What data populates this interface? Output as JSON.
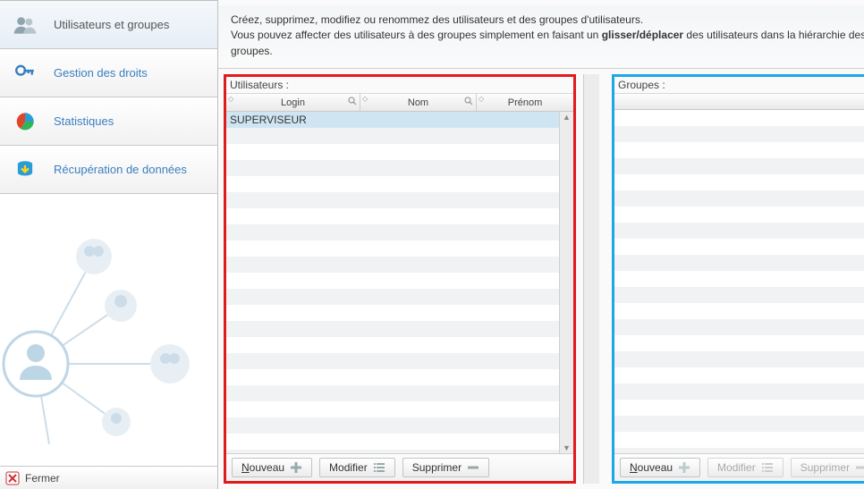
{
  "page_title_truncated": "",
  "description": {
    "line1": "Créez, supprimez, modifiez ou renommez des utilisateurs et des groupes d'utilisateurs.",
    "line2_a": "Vous pouvez affecter des utilisateurs à des groupes simplement en faisant un ",
    "line2_bold": "glisser/déplacer",
    "line2_b": " des utilisateurs dans la hiérarchie des groupes."
  },
  "sidebar": {
    "items": [
      {
        "label": "Utilisateurs et groupes"
      },
      {
        "label": "Gestion des droits"
      },
      {
        "label": "Statistiques"
      },
      {
        "label": "Récupération de données"
      }
    ],
    "close_label": "Fermer"
  },
  "users_panel": {
    "title": "Utilisateurs :",
    "columns": {
      "login": "Login",
      "nom": "Nom",
      "prenom": "Prénom"
    },
    "rows": [
      {
        "login": "SUPERVISEUR",
        "nom": "",
        "prenom": ""
      }
    ],
    "buttons": {
      "new_u": "N",
      "new_rest": "ouveau",
      "modify": "Modifier",
      "delete": "Supprimer"
    }
  },
  "groups_panel": {
    "title": "Groupes :",
    "buttons": {
      "new_u": "N",
      "new_rest": "ouveau",
      "modify": "Modifier",
      "delete": "Supprimer"
    }
  }
}
